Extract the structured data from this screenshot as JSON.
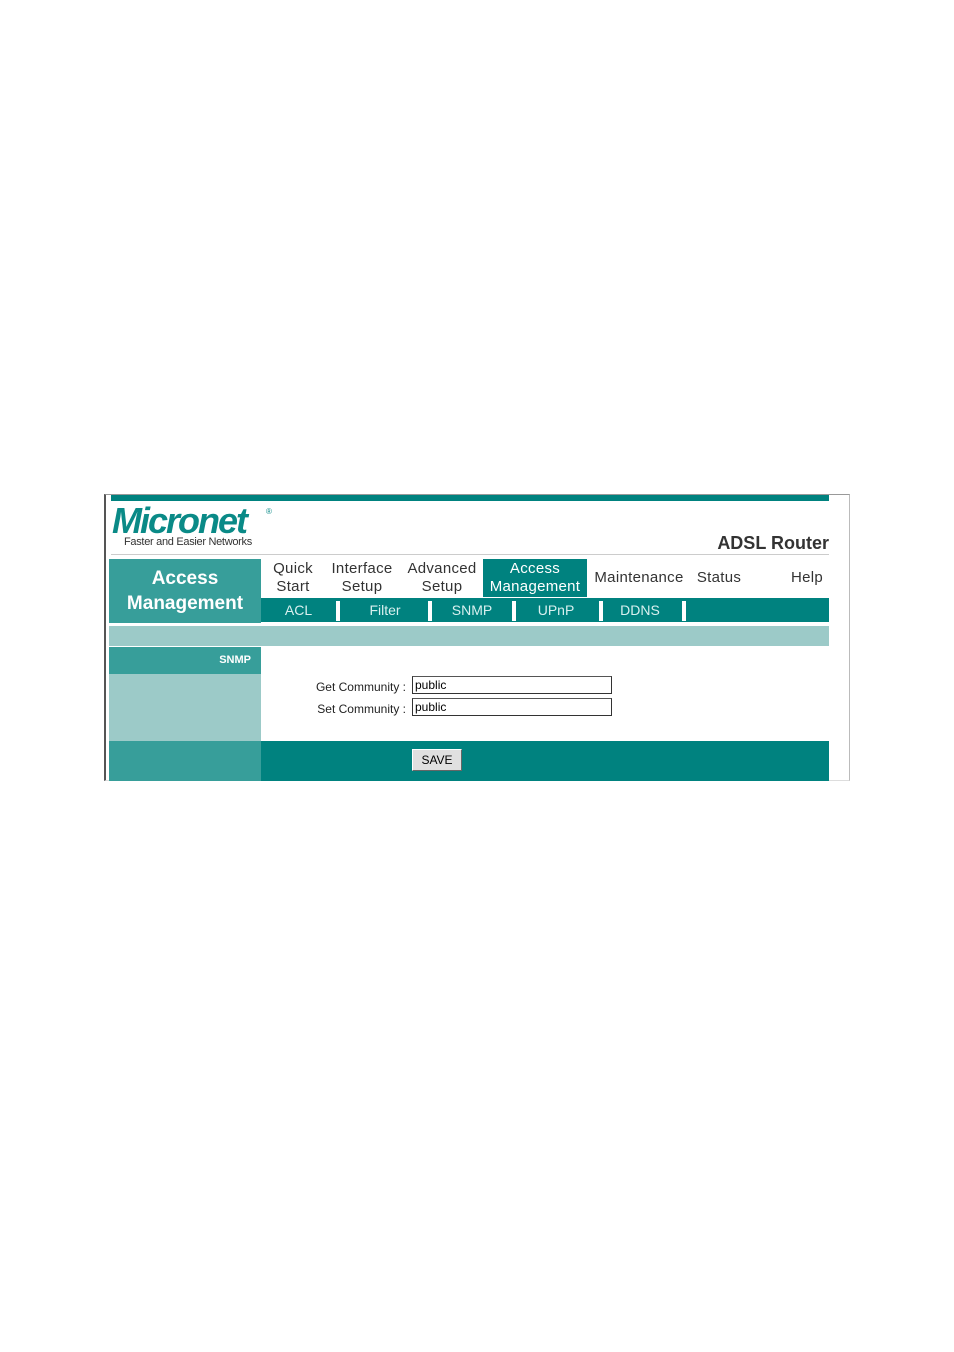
{
  "brand": {
    "logo": "Micronet",
    "registered": "®",
    "tagline": "Faster and Easier Networks"
  },
  "product": "ADSL Router",
  "section_title": [
    "Access",
    "Management"
  ],
  "nav": [
    {
      "line1": "Quick",
      "line2": "Start",
      "active": false
    },
    {
      "line1": "Interface",
      "line2": "Setup",
      "active": false
    },
    {
      "line1": "Advanced",
      "line2": "Setup",
      "active": false
    },
    {
      "line1": "Access",
      "line2": "Management",
      "active": true
    },
    {
      "line1": "Maintenance",
      "line2": "",
      "active": false
    },
    {
      "line1": "Status",
      "line2": "",
      "active": false
    },
    {
      "line1": "Help",
      "line2": "",
      "active": false
    }
  ],
  "subnav": [
    "ACL",
    "Filter",
    "SNMP",
    "UPnP",
    "DDNS"
  ],
  "panel": {
    "label": "SNMP"
  },
  "form": {
    "get_label": "Get Community :",
    "get_value": "public",
    "set_label": "Set Community :",
    "set_value": "public",
    "save_label": "SAVE"
  },
  "colors": {
    "teal": "#00827f",
    "teal_mid": "#379e9a",
    "teal_light": "#9ccac8"
  }
}
